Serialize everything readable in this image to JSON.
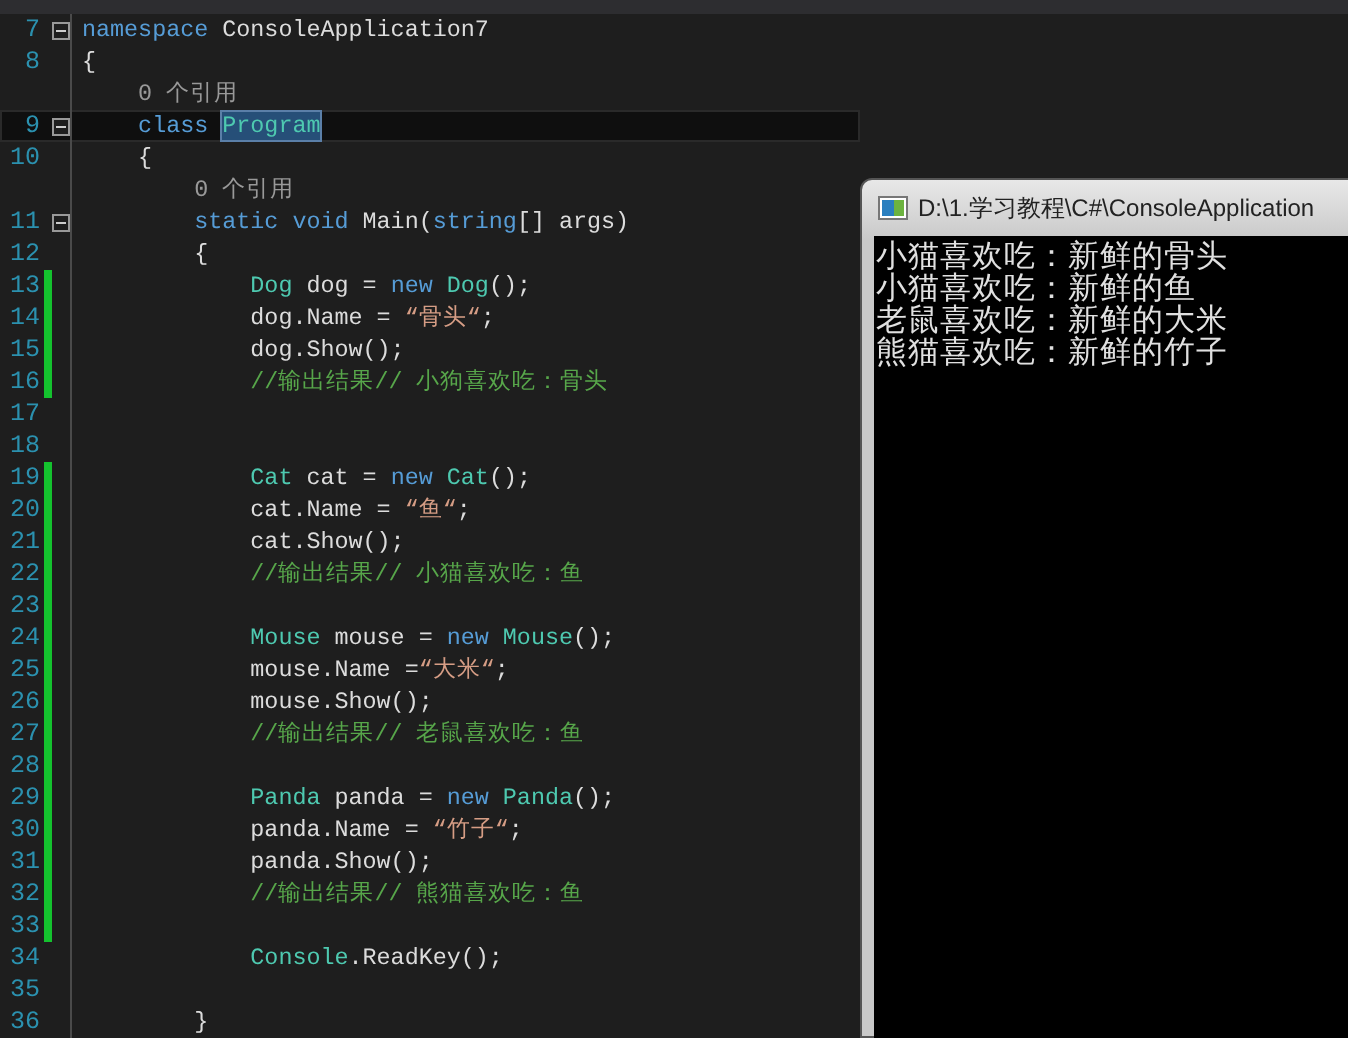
{
  "editor": {
    "lines": [
      {
        "kind": "code",
        "number": "7",
        "foldable": true,
        "changed": false,
        "current": false,
        "tokens": [
          {
            "kind": "keyword",
            "text": "namespace"
          },
          {
            "kind": "plain",
            "text": " ConsoleApplication7"
          }
        ]
      },
      {
        "kind": "code",
        "number": "8",
        "foldable": false,
        "changed": false,
        "current": false,
        "tokens": [
          {
            "kind": "plain",
            "text": "{"
          }
        ]
      },
      {
        "kind": "lens",
        "text": "    0 个引用"
      },
      {
        "kind": "code",
        "number": "9",
        "foldable": true,
        "changed": false,
        "current": true,
        "tokens": [
          {
            "kind": "keyword",
            "text": "    class "
          },
          {
            "kind": "selected-type",
            "text": "Program"
          }
        ]
      },
      {
        "kind": "code",
        "number": "10",
        "foldable": false,
        "changed": false,
        "current": false,
        "tokens": [
          {
            "kind": "plain",
            "text": "    {"
          }
        ]
      },
      {
        "kind": "lens",
        "text": "        0 个引用"
      },
      {
        "kind": "code",
        "number": "11",
        "foldable": true,
        "changed": false,
        "current": false,
        "tokens": [
          {
            "kind": "keyword",
            "text": "        static void"
          },
          {
            "kind": "plain",
            "text": " Main("
          },
          {
            "kind": "keyword",
            "text": "string"
          },
          {
            "kind": "plain",
            "text": "[] args)"
          }
        ]
      },
      {
        "kind": "code",
        "number": "12",
        "foldable": false,
        "changed": false,
        "current": false,
        "tokens": [
          {
            "kind": "plain",
            "text": "        {"
          }
        ]
      },
      {
        "kind": "code",
        "number": "13",
        "foldable": false,
        "changed": true,
        "current": false,
        "tokens": [
          {
            "kind": "type",
            "text": "            Dog"
          },
          {
            "kind": "plain",
            "text": " dog = "
          },
          {
            "kind": "keyword",
            "text": "new"
          },
          {
            "kind": "type",
            "text": " Dog"
          },
          {
            "kind": "plain",
            "text": "();"
          }
        ]
      },
      {
        "kind": "code",
        "number": "14",
        "foldable": false,
        "changed": true,
        "current": false,
        "tokens": [
          {
            "kind": "plain",
            "text": "            dog.Name = "
          },
          {
            "kind": "string",
            "text": "“骨头“"
          },
          {
            "kind": "plain",
            "text": ";"
          }
        ]
      },
      {
        "kind": "code",
        "number": "15",
        "foldable": false,
        "changed": true,
        "current": false,
        "tokens": [
          {
            "kind": "plain",
            "text": "            dog.Show();"
          }
        ]
      },
      {
        "kind": "code",
        "number": "16",
        "foldable": false,
        "changed": true,
        "current": false,
        "tokens": [
          {
            "kind": "comment",
            "text": "            //输出结果// 小狗喜欢吃：骨头"
          }
        ]
      },
      {
        "kind": "code",
        "number": "17",
        "foldable": false,
        "changed": false,
        "current": false
      },
      {
        "kind": "code",
        "number": "18",
        "foldable": false,
        "changed": false,
        "current": false
      },
      {
        "kind": "code",
        "number": "19",
        "foldable": false,
        "changed": true,
        "current": false,
        "tokens": [
          {
            "kind": "type",
            "text": "            Cat"
          },
          {
            "kind": "plain",
            "text": " cat = "
          },
          {
            "kind": "keyword",
            "text": "new"
          },
          {
            "kind": "type",
            "text": " Cat"
          },
          {
            "kind": "plain",
            "text": "();"
          }
        ]
      },
      {
        "kind": "code",
        "number": "20",
        "foldable": false,
        "changed": true,
        "current": false,
        "tokens": [
          {
            "kind": "plain",
            "text": "            cat.Name = "
          },
          {
            "kind": "string",
            "text": "“鱼“"
          },
          {
            "kind": "plain",
            "text": ";"
          }
        ]
      },
      {
        "kind": "code",
        "number": "21",
        "foldable": false,
        "changed": true,
        "current": false,
        "tokens": [
          {
            "kind": "plain",
            "text": "            cat.Show();"
          }
        ]
      },
      {
        "kind": "code",
        "number": "22",
        "foldable": false,
        "changed": true,
        "current": false,
        "tokens": [
          {
            "kind": "comment",
            "text": "            //输出结果// 小猫喜欢吃：鱼"
          }
        ]
      },
      {
        "kind": "code",
        "number": "23",
        "foldable": false,
        "changed": true,
        "current": false
      },
      {
        "kind": "code",
        "number": "24",
        "foldable": false,
        "changed": true,
        "current": false,
        "tokens": [
          {
            "kind": "type",
            "text": "            Mouse"
          },
          {
            "kind": "plain",
            "text": " mouse = "
          },
          {
            "kind": "keyword",
            "text": "new"
          },
          {
            "kind": "type",
            "text": " Mouse"
          },
          {
            "kind": "plain",
            "text": "();"
          }
        ]
      },
      {
        "kind": "code",
        "number": "25",
        "foldable": false,
        "changed": true,
        "current": false,
        "tokens": [
          {
            "kind": "plain",
            "text": "            mouse.Name ="
          },
          {
            "kind": "string",
            "text": "“大米“"
          },
          {
            "kind": "plain",
            "text": ";"
          }
        ]
      },
      {
        "kind": "code",
        "number": "26",
        "foldable": false,
        "changed": true,
        "current": false,
        "tokens": [
          {
            "kind": "plain",
            "text": "            mouse.Show();"
          }
        ]
      },
      {
        "kind": "code",
        "number": "27",
        "foldable": false,
        "changed": true,
        "current": false,
        "tokens": [
          {
            "kind": "comment",
            "text": "            //输出结果// 老鼠喜欢吃：鱼"
          }
        ]
      },
      {
        "kind": "code",
        "number": "28",
        "foldable": false,
        "changed": true,
        "current": false
      },
      {
        "kind": "code",
        "number": "29",
        "foldable": false,
        "changed": true,
        "current": false,
        "tokens": [
          {
            "kind": "type",
            "text": "            Panda"
          },
          {
            "kind": "plain",
            "text": " panda = "
          },
          {
            "kind": "keyword",
            "text": "new"
          },
          {
            "kind": "type",
            "text": " Panda"
          },
          {
            "kind": "plain",
            "text": "();"
          }
        ]
      },
      {
        "kind": "code",
        "number": "30",
        "foldable": false,
        "changed": true,
        "current": false,
        "tokens": [
          {
            "kind": "plain",
            "text": "            panda.Name = "
          },
          {
            "kind": "string",
            "text": "“竹子“"
          },
          {
            "kind": "plain",
            "text": ";"
          }
        ]
      },
      {
        "kind": "code",
        "number": "31",
        "foldable": false,
        "changed": true,
        "current": false,
        "tokens": [
          {
            "kind": "plain",
            "text": "            panda.Show();"
          }
        ]
      },
      {
        "kind": "code",
        "number": "32",
        "foldable": false,
        "changed": true,
        "current": false,
        "tokens": [
          {
            "kind": "comment",
            "text": "            //输出结果// 熊猫喜欢吃：鱼"
          }
        ]
      },
      {
        "kind": "code",
        "number": "33",
        "foldable": false,
        "changed": true,
        "current": false
      },
      {
        "kind": "code",
        "number": "34",
        "foldable": false,
        "changed": false,
        "current": false,
        "tokens": [
          {
            "kind": "type",
            "text": "            Console"
          },
          {
            "kind": "plain",
            "text": ".ReadKey();"
          }
        ]
      },
      {
        "kind": "code",
        "number": "35",
        "foldable": false,
        "changed": false,
        "current": false
      },
      {
        "kind": "code",
        "number": "36",
        "foldable": false,
        "changed": false,
        "current": false,
        "tokens": [
          {
            "kind": "plain",
            "text": "        }"
          }
        ]
      }
    ]
  },
  "console": {
    "title": "D:\\1.学习教程\\C#\\ConsoleApplication",
    "output": [
      "小猫喜欢吃：新鲜的骨头",
      "小猫喜欢吃：新鲜的鱼",
      "老鼠喜欢吃：新鲜的大米",
      "熊猫喜欢吃：新鲜的竹子"
    ]
  }
}
